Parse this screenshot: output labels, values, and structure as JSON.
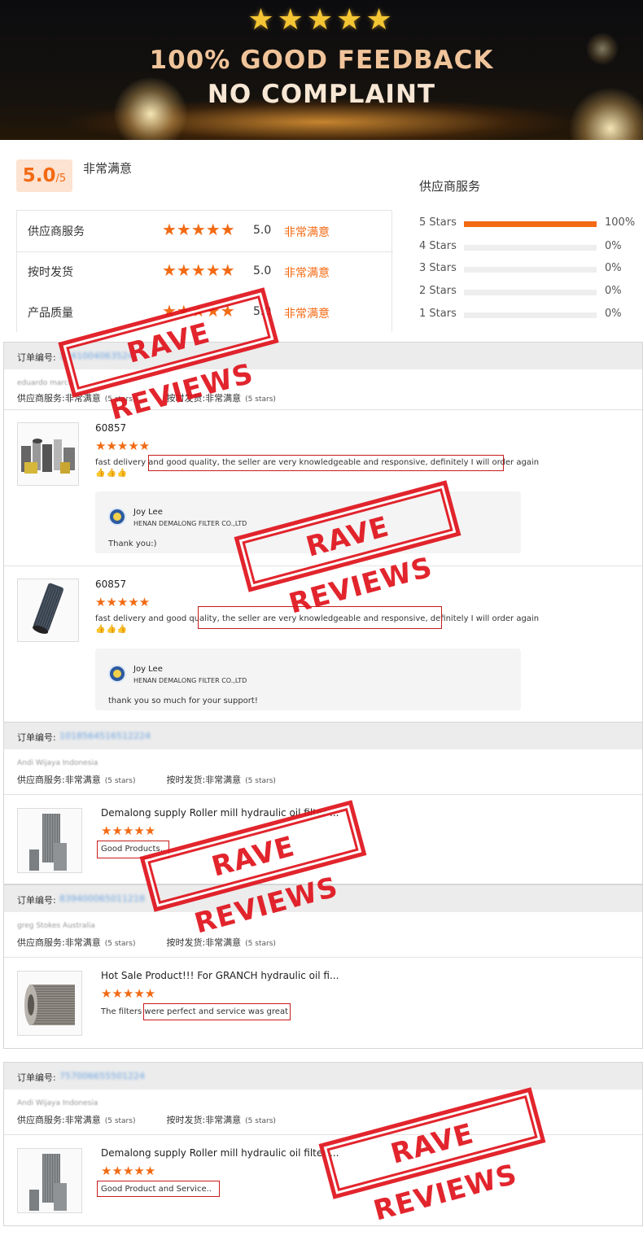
{
  "banner": {
    "stars": "★★★★★",
    "line1": "100% GOOD FEEDBACK",
    "line2": "NO COMPLAINT"
  },
  "summary": {
    "score": "5.0",
    "score_suffix": "/5",
    "score_label": "非常满意",
    "rows": [
      {
        "label": "供应商服务",
        "stars": "★★★★★",
        "value": "5.0",
        "text": "非常满意"
      },
      {
        "label": "按时发货",
        "stars": "★★★★★",
        "value": "5.0",
        "text": "非常满意"
      },
      {
        "label": "产品质量",
        "stars": "★★★★★",
        "value": "5.0",
        "text": "非常满意"
      }
    ]
  },
  "distribution": {
    "title": "供应商服务",
    "rows": [
      {
        "label": "5 Stars",
        "fraction": 1.0,
        "pct": "100%"
      },
      {
        "label": "4 Stars",
        "fraction": 0.0,
        "pct": "0%"
      },
      {
        "label": "3 Stars",
        "fraction": 0.0,
        "pct": "0%"
      },
      {
        "label": "2 Stars",
        "fraction": 0.0,
        "pct": "0%"
      },
      {
        "label": "1 Stars",
        "fraction": 0.0,
        "pct": "0%"
      }
    ]
  },
  "stamp_text": "RAVE  REVIEWS",
  "sections": [
    {
      "order_label": "订单编号:",
      "order_no": "1241004063524",
      "buyer": "eduardo marcos",
      "supplier_service": "供应商服务:",
      "supplier_value": "非常满意",
      "stars_note": "(5 stars)",
      "ontime": "按时发货:",
      "ontime_value": "非常满意",
      "reviews": [
        {
          "product": "60857",
          "stars": "★★★★★",
          "text": "fast delivery and good quality, the seller are very knowledgeable and responsive, definitely I will order again",
          "thumbs": "👍👍👍",
          "reply_name": "Joy Lee",
          "reply_company": "HENAN DEMALONG FILTER CO.,LTD",
          "reply_msg": "Thank you:)"
        },
        {
          "product": "60857",
          "stars": "★★★★★",
          "text": "fast delivery and good quality, the seller are very knowledgeable and responsive, definitely I will order again",
          "thumbs": "👍👍👍",
          "reply_name": "Joy Lee",
          "reply_company": "HENAN DEMALONG FILTER CO.,LTD",
          "reply_msg": "thank you so much for your support!"
        }
      ]
    },
    {
      "order_label": "订单编号:",
      "order_no": "1018564516512224",
      "buyer": "Andi Wijaya Indonesia",
      "supplier_service": "供应商服务:",
      "supplier_value": "非常满意",
      "stars_note": "(5 stars)",
      "ontime": "按时发货:",
      "ontime_value": "非常满意",
      "product": "Demalong supply Roller mill hydraulic oil filter ...",
      "stars": "★★★★★",
      "text": "Good Products.."
    },
    {
      "order_label": "订单编号:",
      "order_no": "839400065011218",
      "buyer": "greg Stokes Australia",
      "supplier_service": "供应商服务:",
      "supplier_value": "非常满意",
      "stars_note": "(5 stars)",
      "ontime": "按时发货:",
      "ontime_value": "非常满意",
      "product": "Hot Sale Product!!! For GRANCH hydraulic oil fi...",
      "stars": "★★★★★",
      "text": "The filters were perfect and service was great"
    },
    {
      "order_label": "订单编号:",
      "order_no": "757006655501224",
      "buyer": "Andi Wijaya Indonesia",
      "supplier_service": "供应商服务:",
      "supplier_value": "非常满意",
      "stars_note": "(5 stars)",
      "ontime": "按时发货:",
      "ontime_value": "非常满意",
      "product": "Demalong supply Roller mill hydraulic oil filter ...",
      "stars": "★★★★★",
      "text": "Good Product and Service.."
    }
  ]
}
